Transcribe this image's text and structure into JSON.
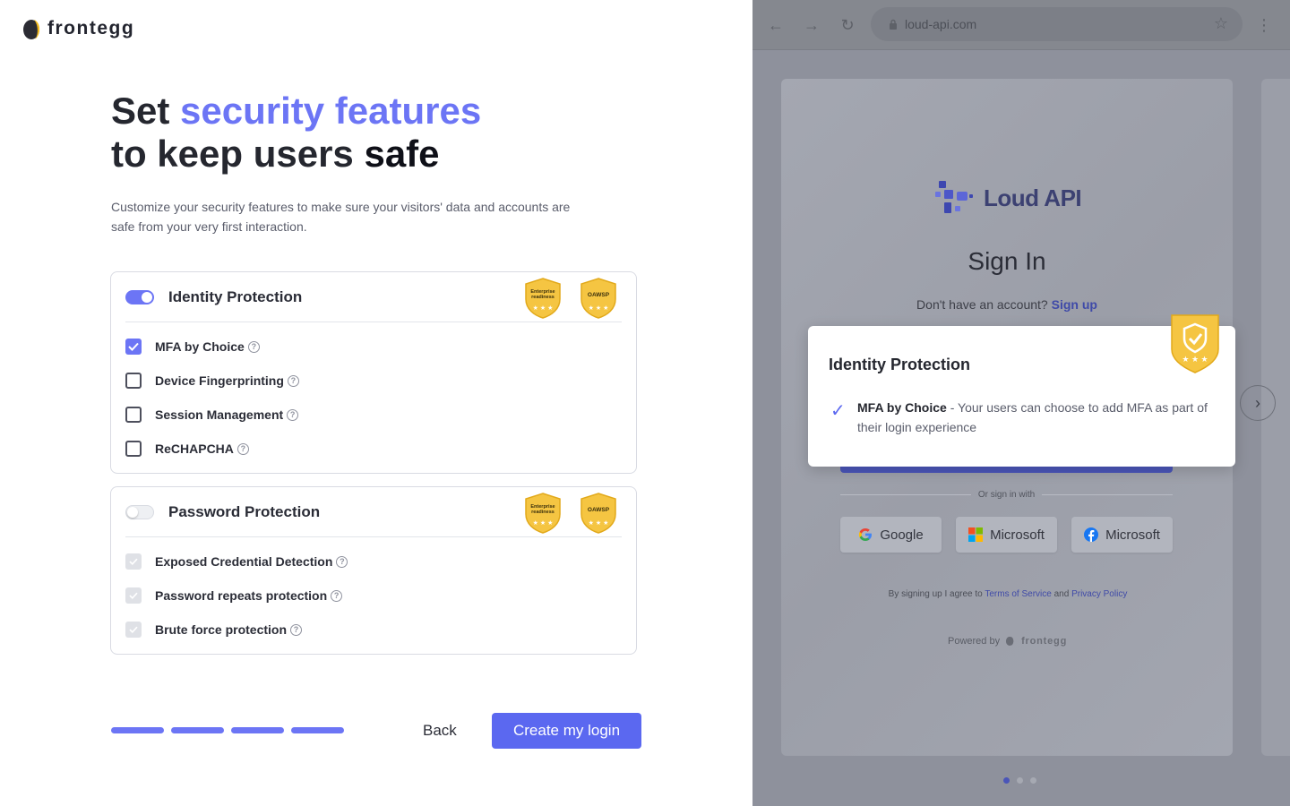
{
  "brand": {
    "name": "frontegg"
  },
  "headline": {
    "line1_prefix": "Set ",
    "line1_accent": "security features",
    "line2_prefix": "to keep users ",
    "line2_bold": "safe"
  },
  "subtitle": "Customize your security features to make sure your visitors' data and accounts are safe from your very first interaction.",
  "badges": {
    "enterprise": "Enterprise readiness",
    "oawsp": "OAWSP"
  },
  "identity": {
    "title": "Identity Protection",
    "enabled": true,
    "options": [
      {
        "label": "MFA by Choice",
        "checked": true
      },
      {
        "label": "Device Fingerprinting",
        "checked": false
      },
      {
        "label": "Session Management",
        "checked": false
      },
      {
        "label": "ReCHAPCHA",
        "checked": false
      }
    ]
  },
  "password": {
    "title": "Password Protection",
    "enabled": false,
    "options": [
      {
        "label": "Exposed Credential Detection"
      },
      {
        "label": "Password repeats protection"
      },
      {
        "label": "Brute force protection"
      }
    ]
  },
  "footer": {
    "steps_completed": 4,
    "back_label": "Back",
    "create_label": "Create my login"
  },
  "browser": {
    "url": "loud-api.com",
    "app_name": "Loud API",
    "signin_title": "Sign In",
    "signup_prompt": "Don't have an account?",
    "signup_link": "Sign up",
    "or_text": "Or sign in with",
    "social": [
      {
        "label": "Google",
        "icon": "google-icon"
      },
      {
        "label": "Microsoft",
        "icon": "microsoft-icon"
      },
      {
        "label": "Microsoft",
        "icon": "facebook-icon"
      }
    ],
    "terms_prefix": "By signing up I agree to",
    "terms_link": "Terms of Service",
    "terms_and": "and",
    "privacy_link": "Privacy Policy",
    "powered_by": "Powered by",
    "powered_brand": "frontegg",
    "carousel_active": 1,
    "carousel_total": 3
  },
  "popover": {
    "title": "Identity Protection",
    "feature": "MFA by Choice",
    "description": " - Your users can choose to add MFA as part of their login experience"
  },
  "colors": {
    "accent": "#6c75f5",
    "primary_button": "#5b68f0",
    "badge_gold": "#f5c542"
  }
}
